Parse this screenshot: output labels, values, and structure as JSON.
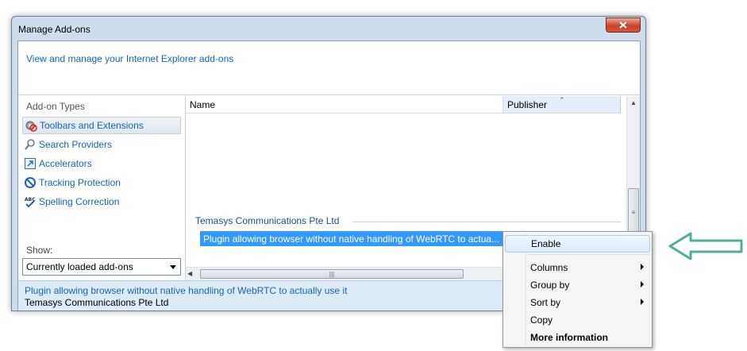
{
  "window": {
    "title": "Manage Add-ons",
    "header_link": "View and manage your Internet Explorer add-ons"
  },
  "left_pane": {
    "types_label": "Add-on Types",
    "items": [
      {
        "label": "Toolbars and Extensions",
        "icon": "gear-icon",
        "selected": true
      },
      {
        "label": "Search Providers",
        "icon": "search-icon",
        "selected": false
      },
      {
        "label": "Accelerators",
        "icon": "accelerator-icon",
        "selected": false
      },
      {
        "label": "Tracking Protection",
        "icon": "no-entry-icon",
        "selected": false
      },
      {
        "label": "Spelling Correction",
        "icon": "spell-check-icon",
        "selected": false
      }
    ],
    "show_label": "Show:",
    "show_value": "Currently loaded add-ons"
  },
  "list": {
    "columns": [
      "Name",
      "Publisher"
    ],
    "group": "Temasys Communications Pte Ltd",
    "selected_row": "Plugin allowing browser without native handling of WebRTC to actua..."
  },
  "details": {
    "name": "Plugin allowing browser without native handling of WebRTC to actually use it",
    "publisher": "Temasys Communications Pte Ltd"
  },
  "context_menu": {
    "items": [
      {
        "label": "Enable",
        "highlighted": true,
        "submenu": false,
        "bold": false
      },
      {
        "label": "Columns",
        "highlighted": false,
        "submenu": true,
        "bold": false
      },
      {
        "label": "Group by",
        "highlighted": false,
        "submenu": true,
        "bold": false
      },
      {
        "label": "Sort by",
        "highlighted": false,
        "submenu": true,
        "bold": false
      },
      {
        "label": "Copy",
        "highlighted": false,
        "submenu": false,
        "bold": false
      },
      {
        "label": "More information",
        "highlighted": false,
        "submenu": false,
        "bold": true
      }
    ]
  },
  "colors": {
    "link": "#1664b8",
    "selection": "#3399ff",
    "annotation_arrow": "#4fae98"
  }
}
